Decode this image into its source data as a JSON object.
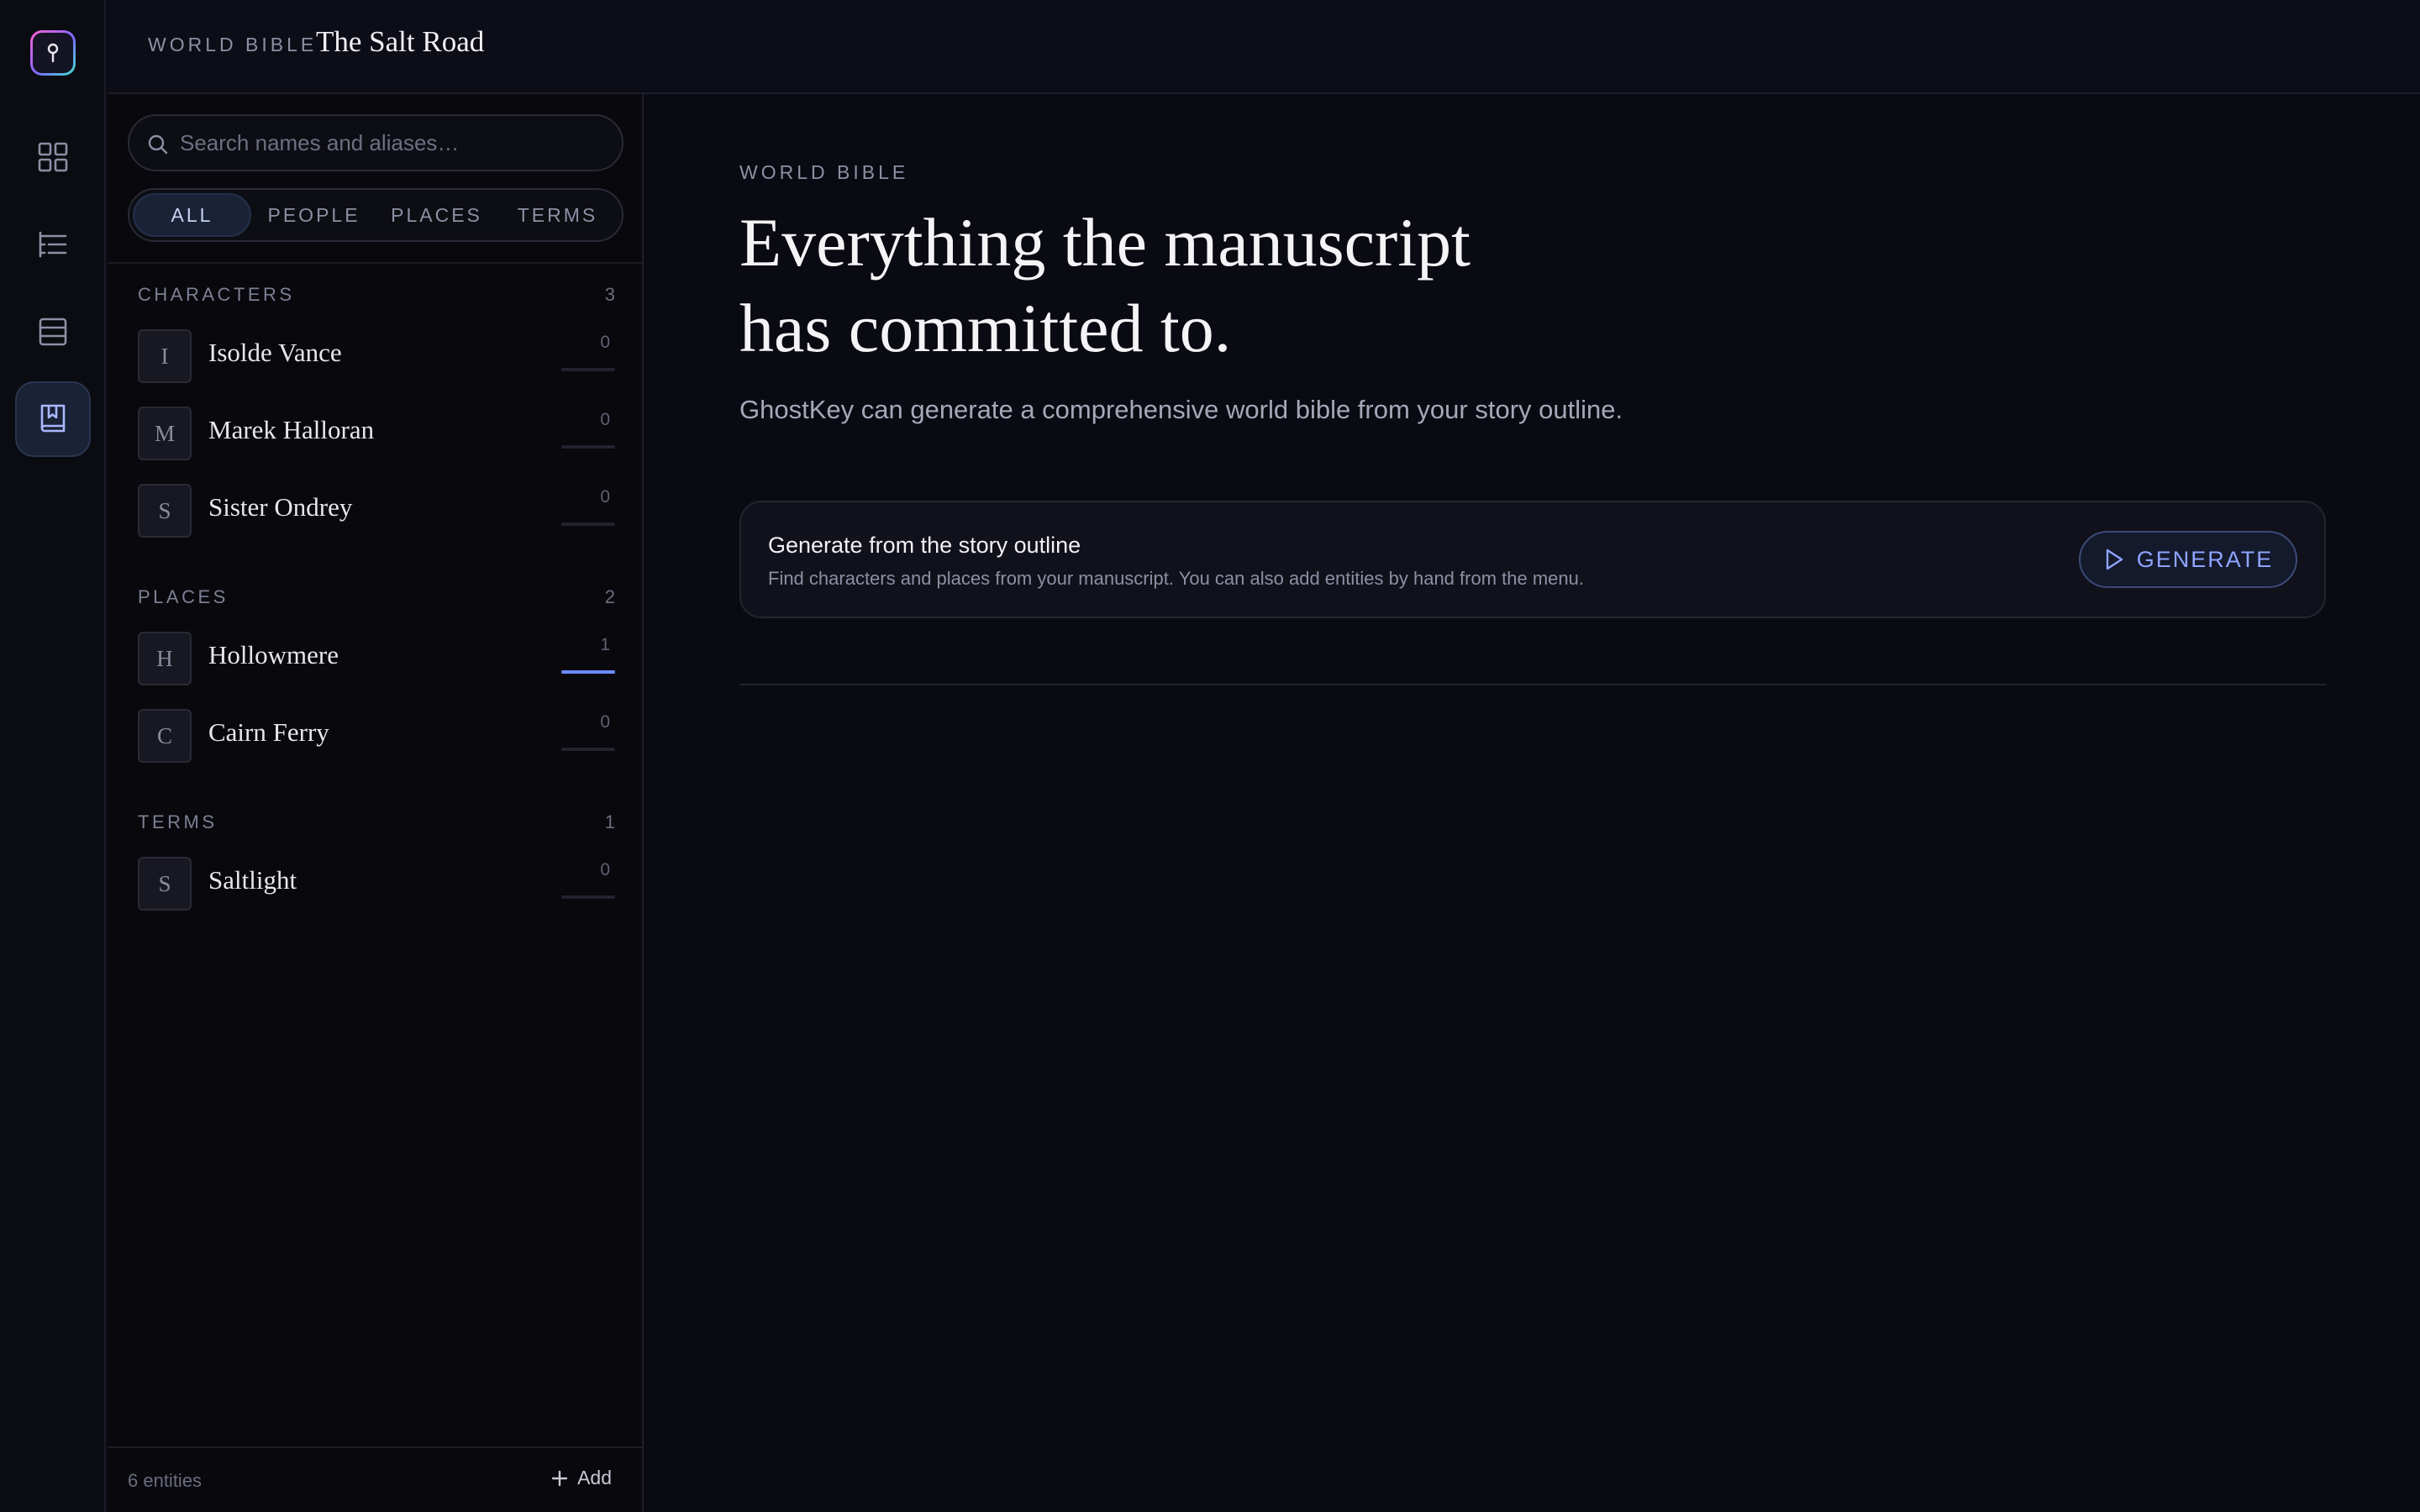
{
  "header": {
    "section_label": "WORLD BIBLE",
    "project_title": "The Salt Road"
  },
  "rail": {
    "items": [
      "dashboard-icon",
      "outline-icon",
      "chapters-icon",
      "world-bible-icon"
    ],
    "active": "world-bible-icon"
  },
  "search": {
    "placeholder": "Search names and aliases…",
    "value": ""
  },
  "filters": {
    "tabs": [
      "ALL",
      "PEOPLE",
      "PLACES",
      "TERMS"
    ],
    "active": "ALL"
  },
  "sections": [
    {
      "title": "CHARACTERS",
      "count": "3",
      "items": [
        {
          "initial": "I",
          "name": "Isolde Vance",
          "mentions": "0",
          "progress": 0
        },
        {
          "initial": "M",
          "name": "Marek Halloran",
          "mentions": "0",
          "progress": 0
        },
        {
          "initial": "S",
          "name": "Sister Ondrey",
          "mentions": "0",
          "progress": 0
        }
      ]
    },
    {
      "title": "PLACES",
      "count": "2",
      "items": [
        {
          "initial": "H",
          "name": "Hollowmere",
          "mentions": "1",
          "progress": 1
        },
        {
          "initial": "C",
          "name": "Cairn Ferry",
          "mentions": "0",
          "progress": 0
        }
      ]
    },
    {
      "title": "TERMS",
      "count": "1",
      "items": [
        {
          "initial": "S",
          "name": "Saltlight",
          "mentions": "0",
          "progress": 0
        }
      ]
    }
  ],
  "footer": {
    "entity_total": "6 entities",
    "add_label": "Add"
  },
  "main": {
    "eyebrow": "WORLD BIBLE",
    "headline_line1": "Everything the manuscript",
    "headline_line2": "has committed to.",
    "lede": "GhostKey can generate a comprehensive world bible from your story outline.",
    "card": {
      "title": "Generate from the story outline",
      "description": "Find characters and places from your manuscript. You can also add entities by hand from the menu.",
      "button_label": "GENERATE"
    }
  },
  "colors": {
    "accent": "#8ea4ff",
    "background": "#0a0a12",
    "panel": "#08080d"
  }
}
